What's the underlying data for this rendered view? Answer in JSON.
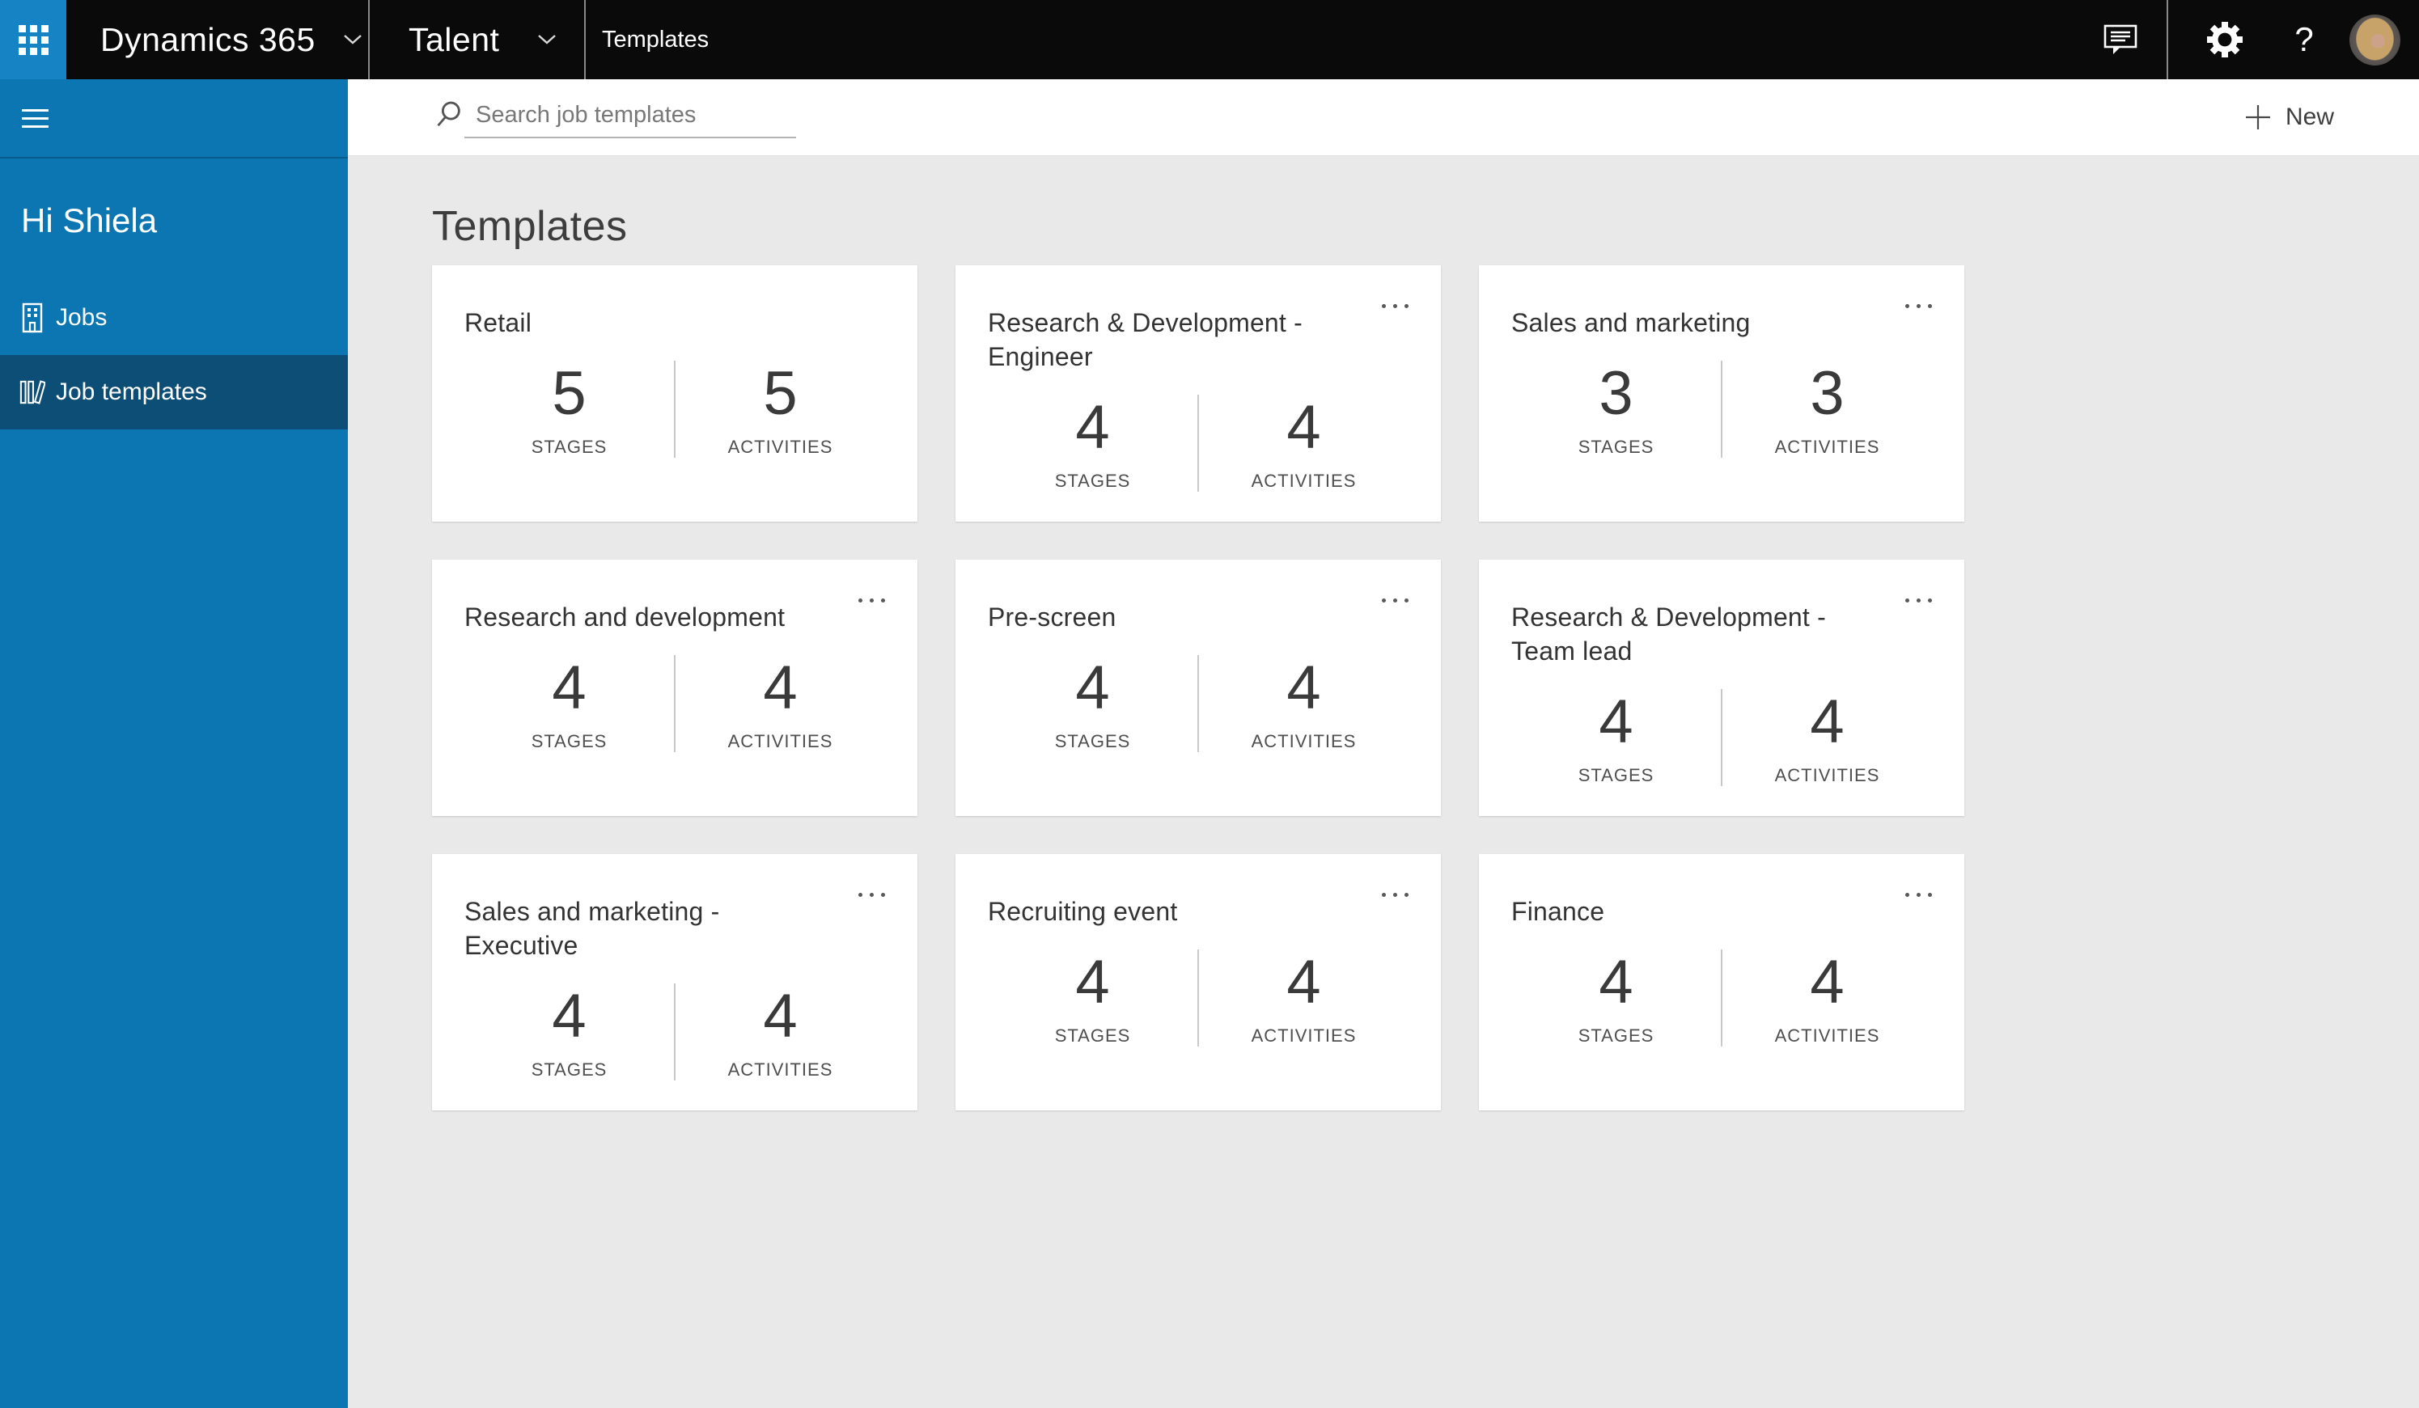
{
  "topbar": {
    "app_label": "Dynamics 365",
    "module_label": "Talent",
    "page_label": "Templates"
  },
  "sidebar": {
    "greeting": "Hi Shiela",
    "items": [
      {
        "label": "Jobs",
        "icon": "building-icon",
        "selected": false
      },
      {
        "label": "Job templates",
        "icon": "books-icon",
        "selected": true
      }
    ]
  },
  "header": {
    "search_placeholder": "Search job templates",
    "new_label": "New"
  },
  "main": {
    "title": "Templates",
    "stages_label": "STAGES",
    "activities_label": "ACTIVITIES",
    "cards": [
      {
        "title": "Retail",
        "stages": 5,
        "activities": 5,
        "menu": false
      },
      {
        "title": "Research & Development - Engineer",
        "stages": 4,
        "activities": 4,
        "menu": true
      },
      {
        "title": "Sales and marketing",
        "stages": 3,
        "activities": 3,
        "menu": true
      },
      {
        "title": "Research and development",
        "stages": 4,
        "activities": 4,
        "menu": true
      },
      {
        "title": "Pre-screen",
        "stages": 4,
        "activities": 4,
        "menu": true
      },
      {
        "title": "Research & Development - Team lead",
        "stages": 4,
        "activities": 4,
        "menu": true
      },
      {
        "title": "Sales and marketing - Executive",
        "stages": 4,
        "activities": 4,
        "menu": true
      },
      {
        "title": "Recruiting event",
        "stages": 4,
        "activities": 4,
        "menu": true
      },
      {
        "title": "Finance",
        "stages": 4,
        "activities": 4,
        "menu": true
      }
    ]
  },
  "icons": {
    "topbar_left": [
      "waffle-icon",
      "chevron-down-icon"
    ],
    "topbar_right": [
      "feedback-icon",
      "settings-gear-icon",
      "help-icon",
      "user-avatar"
    ],
    "sidebar": [
      "hamburger-icon",
      "building-icon",
      "books-icon"
    ],
    "header": [
      "search-icon",
      "plus-icon"
    ],
    "card": [
      "more-options-icon"
    ]
  },
  "colors": {
    "topbar_bg": "#0a0a0a",
    "waffle_bg": "#1583c4",
    "sidebar_bg": "#0b76b2",
    "sidebar_selected_bg": "#0c4e75",
    "header_bg": "#ffffff",
    "content_bg": "#e9e9e9",
    "card_bg": "#ffffff"
  }
}
